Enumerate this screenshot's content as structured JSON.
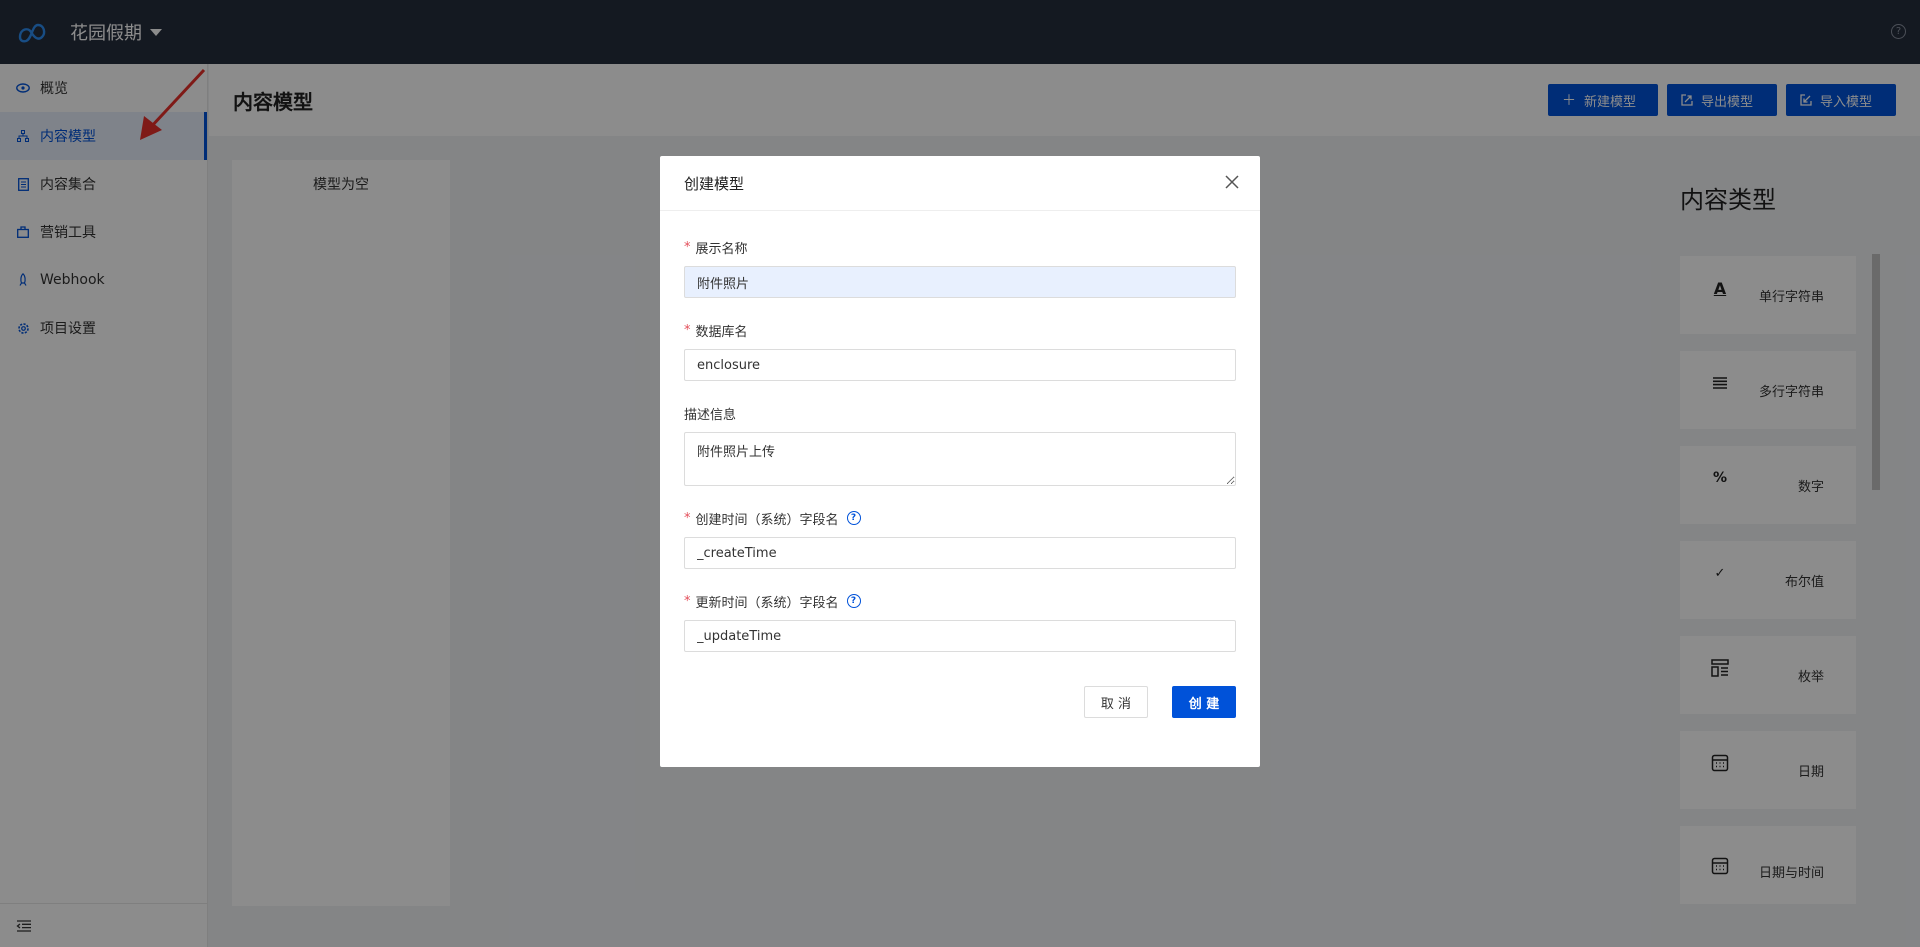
{
  "topbar": {
    "project_name": "花园假期"
  },
  "sidebar": {
    "items": [
      {
        "label": "概览",
        "icon": "eye-icon"
      },
      {
        "label": "内容模型",
        "icon": "model-icon"
      },
      {
        "label": "内容集合",
        "icon": "collection-icon"
      },
      {
        "label": "营销工具",
        "icon": "bag-icon"
      },
      {
        "label": "Webhook",
        "icon": "rocket-icon"
      },
      {
        "label": "项目设置",
        "icon": "gear-icon"
      }
    ],
    "active_index": 1
  },
  "header": {
    "title": "内容模型",
    "buttons": {
      "new_model": "新建模型",
      "export_model": "导出模型",
      "import_model": "导入模型"
    }
  },
  "model_list": {
    "empty_text": "模型为空"
  },
  "content_types": {
    "title": "内容类型",
    "items": [
      {
        "label": "单行字符串",
        "icon": "single-line-text-icon"
      },
      {
        "label": "多行字符串",
        "icon": "multi-line-text-icon"
      },
      {
        "label": "数字",
        "icon": "percent-icon"
      },
      {
        "label": "布尔值",
        "icon": "check-icon"
      },
      {
        "label": "枚举",
        "icon": "enum-icon"
      },
      {
        "label": "日期",
        "icon": "calendar-icon"
      },
      {
        "label": "日期与时间",
        "icon": "calendar-icon"
      }
    ]
  },
  "modal": {
    "title": "创建模型",
    "fields": {
      "display_name": {
        "label": "展示名称",
        "value": "附件照片"
      },
      "db_name": {
        "label": "数据库名",
        "value": "enclosure"
      },
      "description": {
        "label": "描述信息",
        "value": "附件照片上传"
      },
      "create_time": {
        "label": "创建时间（系统）字段名",
        "value": "_createTime"
      },
      "update_time": {
        "label": "更新时间（系统）字段名",
        "value": "_updateTime"
      }
    },
    "cancel_label": "取 消",
    "create_label": "创 建"
  },
  "colors": {
    "primary": "#0052d9",
    "topbar": "#262e3d",
    "required": "#e34d59"
  }
}
